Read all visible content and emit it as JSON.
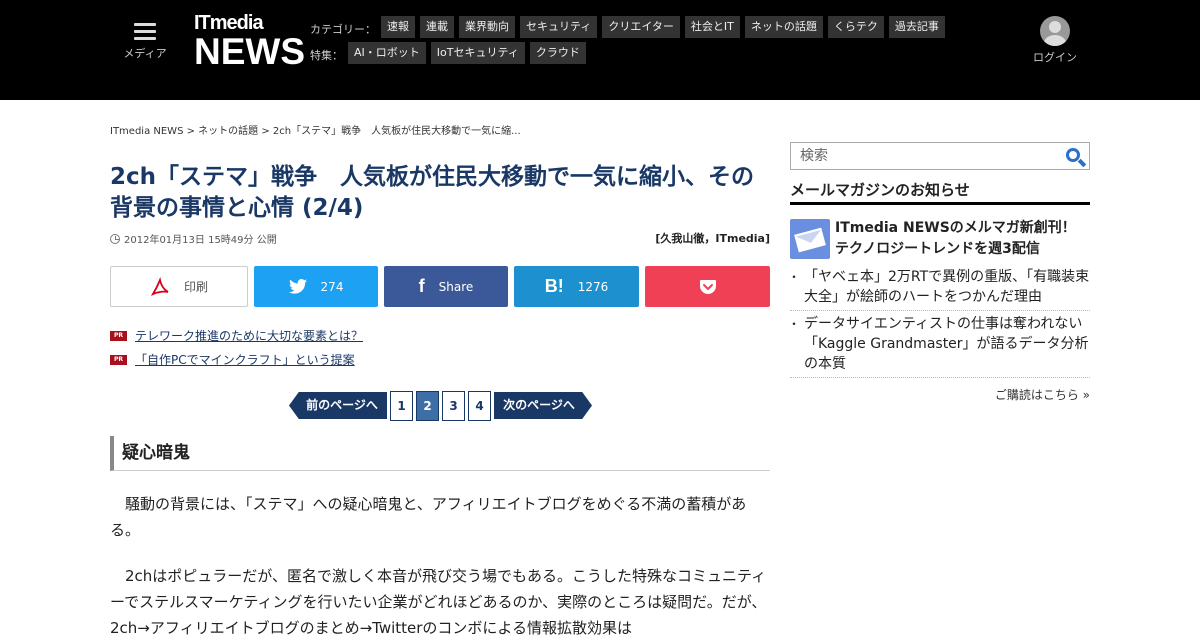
{
  "header": {
    "media_label": "メディア",
    "logo_top": "ITmedia",
    "logo_main": "NEWS",
    "category_label": "カテゴリー：",
    "categories": [
      "速報",
      "連載",
      "業界動向",
      "セキュリティ",
      "クリエイター",
      "社会とIT",
      "ネットの話題",
      "くらテク",
      "過去記事"
    ],
    "feature_label": "特集：",
    "features": [
      "AI・ロボット",
      "IoTセキュリティ",
      "クラウド"
    ],
    "login_label": "ログイン"
  },
  "breadcrumb": "ITmedia NEWS > ネットの話題 > 2ch「ステマ」戦争　人気板が住民大移動で一気に縮...",
  "article": {
    "title": "2ch「ステマ」戦争　人気板が住民大移動で一気に縮小、その背景の事情と心情 (2/4)",
    "date": "2012年01月13日 15時49分 公開",
    "author": "[久我山徹，ITmedia]"
  },
  "share": {
    "print_label": "印刷",
    "twitter_count": "274",
    "facebook_label": "Share",
    "hatena_count": "1276"
  },
  "pr_links": [
    {
      "badge": "PR",
      "text": "テレワーク推進のために大切な要素とは？"
    },
    {
      "badge": "PR",
      "text": "「自作PCでマインクラフト」という提案"
    }
  ],
  "pager": {
    "prev_label": "前のページへ",
    "next_label": "次のページへ",
    "pages": [
      "1",
      "2",
      "3",
      "4"
    ],
    "current": "2"
  },
  "section": {
    "heading": "疑心暗鬼",
    "paragraphs": [
      "騒動の背景には、「ステマ」への疑心暗鬼と、アフィリエイトブログをめぐる不満の蓄積がある。",
      "2chはポピュラーだが、匿名で激しく本音が飛び交う場でもある。こうした特殊なコミュニティーでステルスマーケティングを行いたい企業がどれほどあるのか、実際のところは疑問だ。だが、2ch→アフィリエイトブログのまとめ→Twitterのコンボによる情報拡散効果は"
    ]
  },
  "sidebar": {
    "search_placeholder": "検索",
    "newsletter_heading": "メールマガジンのお知らせ",
    "newsletter_title": "ITmedia NEWSのメルマガ新創刊！ テクノロジートレンドを週3配信",
    "items": [
      "「ヤベェ本」2万RTで異例の重版、「有職装束大全」が絵師のハートをつかんだ理由",
      "データサイエンティストの仕事は奪われない　「Kaggle Grandmaster」が語るデータ分析の本質"
    ],
    "subscribe_link": "ご購読はこちら »"
  },
  "colors": {
    "header_bg": "#000000",
    "title": "#1a3866",
    "twitter": "#1da1f2",
    "facebook": "#3b5998",
    "hatena": "#1d91d0",
    "pocket": "#ef4056",
    "pr_badge": "#a8101e"
  }
}
